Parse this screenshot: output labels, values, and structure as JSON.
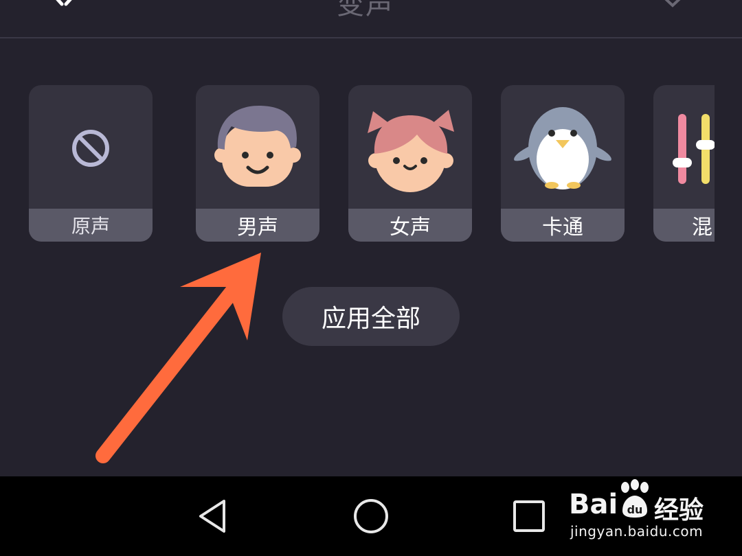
{
  "header": {
    "title_fragment": "变声",
    "close_icon": "close-icon",
    "right_icon": "chevron-down-icon"
  },
  "effects": [
    {
      "label": "原声",
      "icon": "disabled-circle-icon"
    },
    {
      "label": "男声",
      "icon": "boy-face-icon"
    },
    {
      "label": "女声",
      "icon": "girl-face-icon"
    },
    {
      "label": "卡通",
      "icon": "penguin-icon"
    },
    {
      "label": "混",
      "icon": "mixer-sliders-icon"
    }
  ],
  "apply_all_label": "应用全部",
  "annotation": {
    "arrow_color": "#ff6b3d"
  },
  "navbar": {
    "back_icon": "back-triangle-icon",
    "home_icon": "home-circle-icon",
    "recents_icon": "recents-square-icon"
  },
  "watermark": {
    "brand_text": "Bai",
    "brand_mark": "du",
    "suffix": "经验",
    "url": "jingyan.baidu.com"
  },
  "colors": {
    "background": "#24222d",
    "card": "#35333f",
    "card_label": "#5a5967",
    "accent": "#ff6b3d"
  }
}
